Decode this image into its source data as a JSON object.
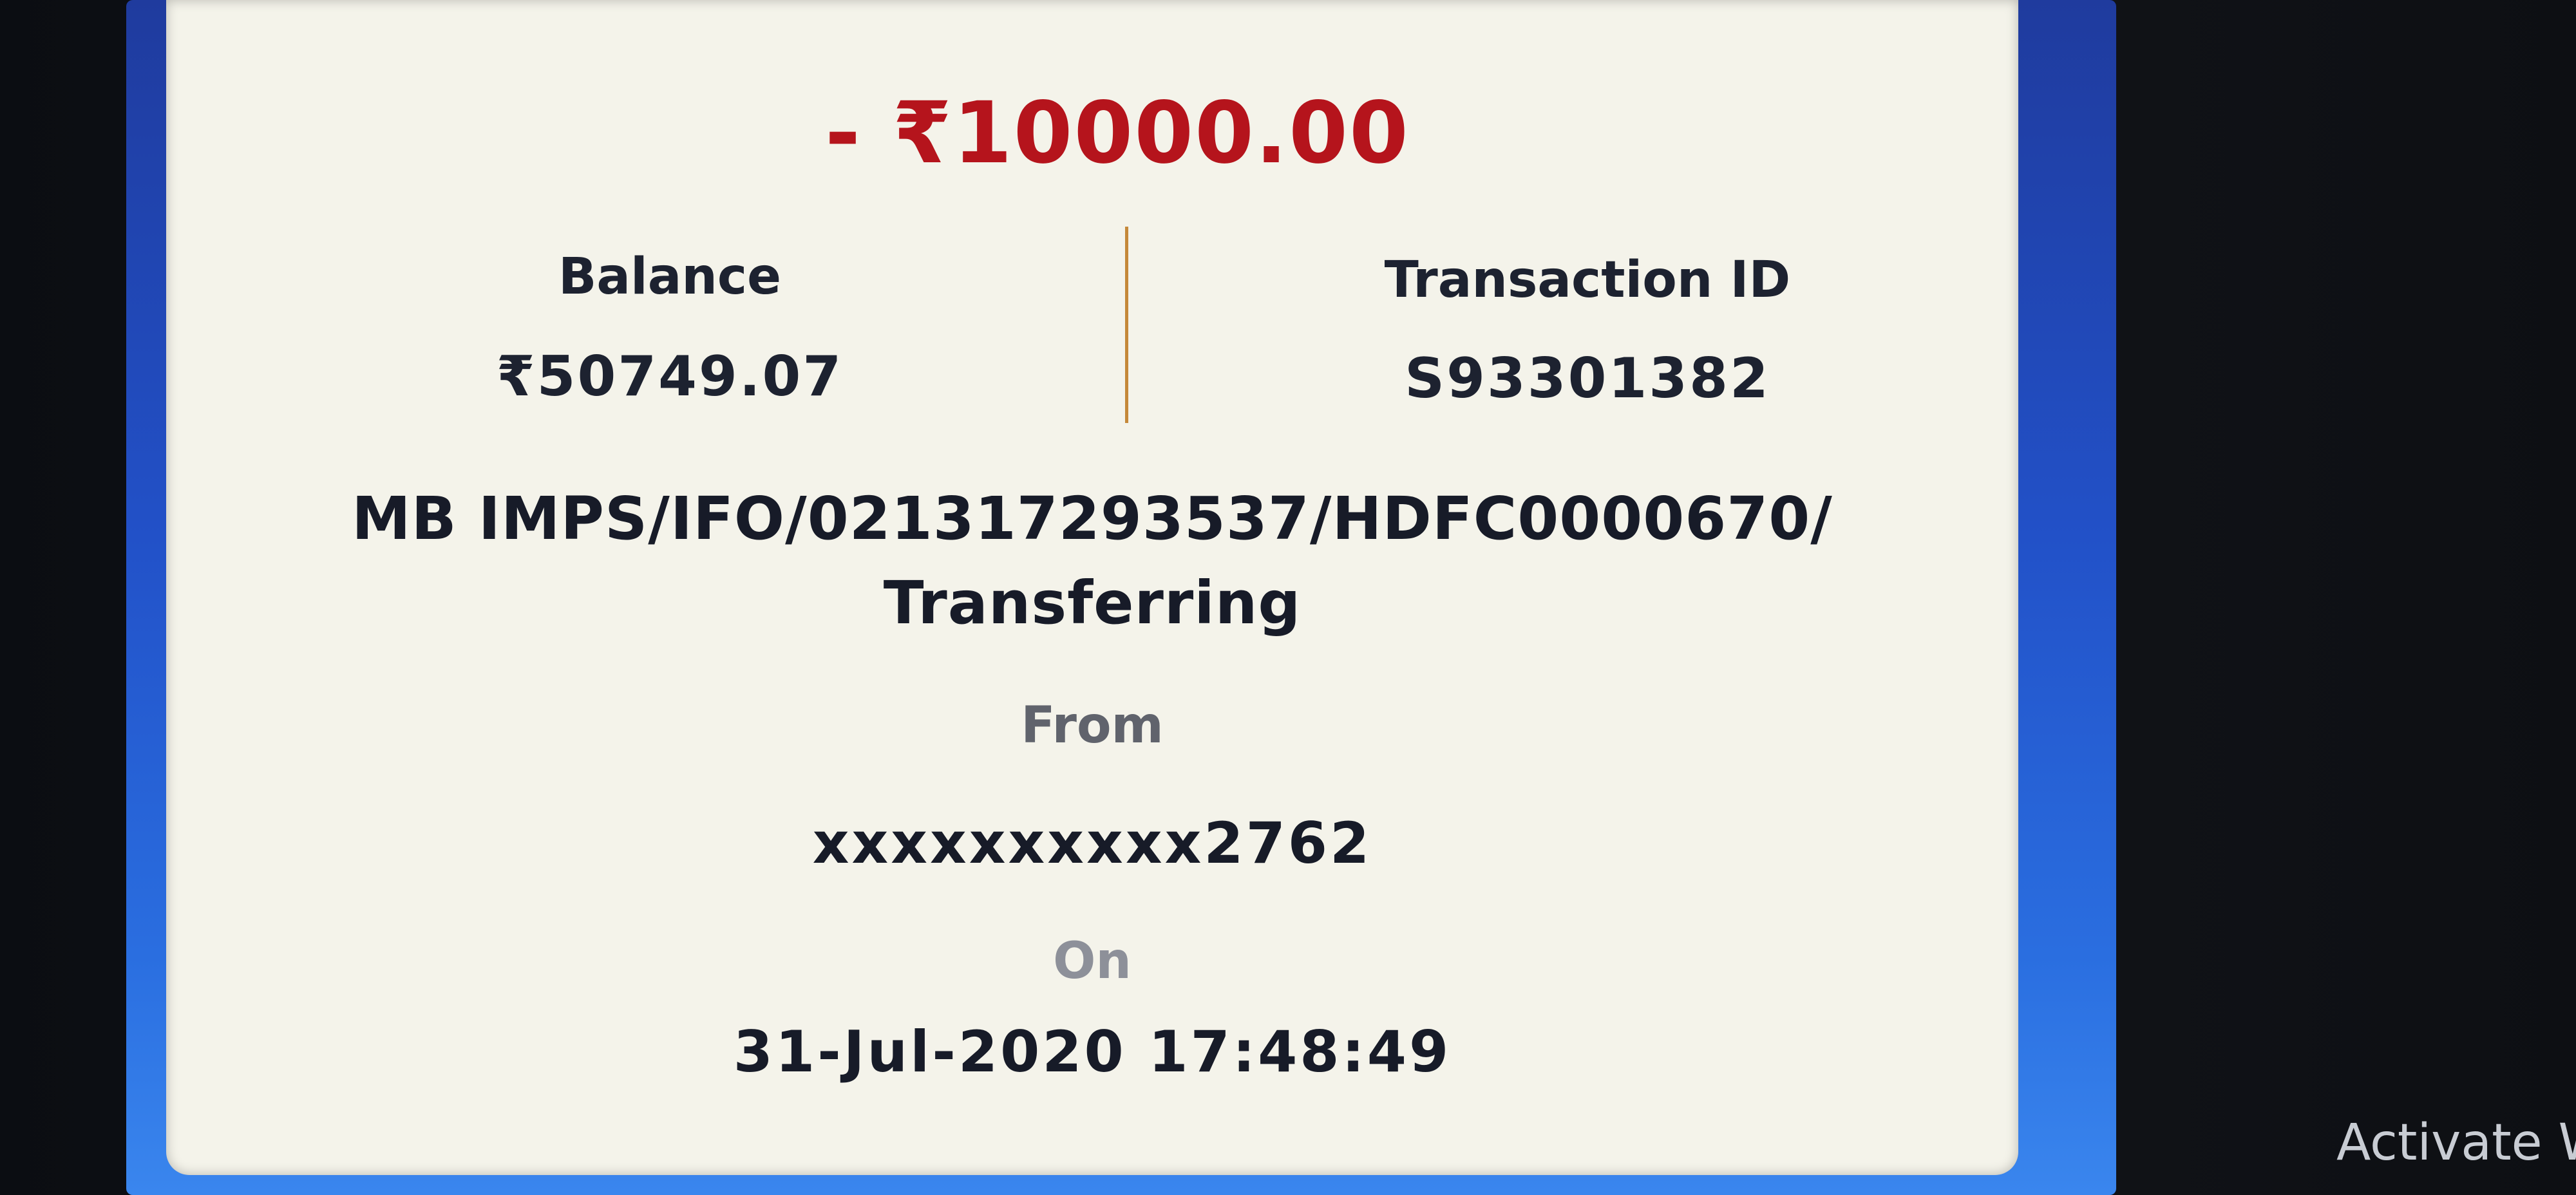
{
  "transaction": {
    "amount": "- ₹10000.00",
    "balance_label": "Balance",
    "balance_value": "₹50749.07",
    "transaction_id_label": "Transaction ID",
    "transaction_id_value": "S93301382",
    "description_line1": "MB IMPS/IFO/021317293537/HDFC0000670/",
    "description_line2": "Transferring",
    "from_label": "From",
    "from_value": "xxxxxxxxxx2762",
    "on_label": "On",
    "on_value": "31-Jul-2020 17:48:49"
  },
  "system": {
    "activate_text": "Activate W"
  },
  "colors": {
    "amount": "#b5141c",
    "divider": "#c5893a",
    "card": "#f4f3ea",
    "frame": "#2251c8"
  }
}
